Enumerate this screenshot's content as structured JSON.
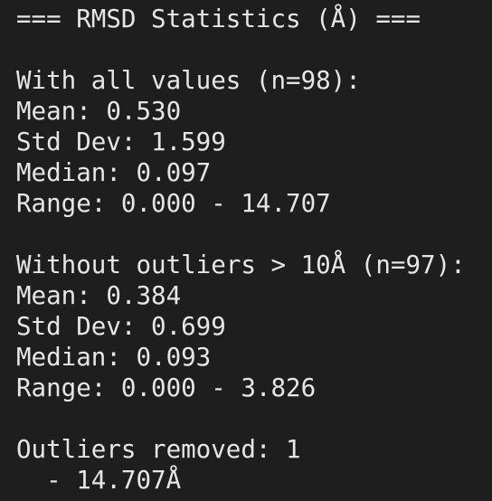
{
  "terminal": {
    "header": "=== RMSD Statistics (Å) ===",
    "all_values": {
      "heading": "With all values (n=98):",
      "mean": "Mean: 0.530",
      "std": "Std Dev: 1.599",
      "median": "Median: 0.097",
      "range": "Range: 0.000 - 14.707"
    },
    "without_outliers": {
      "heading": "Without outliers > 10Å (n=97):",
      "mean": "Mean: 0.384",
      "std": "Std Dev: 0.699",
      "median": "Median: 0.093",
      "range": "Range: 0.000 - 3.826"
    },
    "outliers": {
      "heading": "Outliers removed: 1",
      "items": [
        "  - 14.707Å"
      ]
    }
  }
}
